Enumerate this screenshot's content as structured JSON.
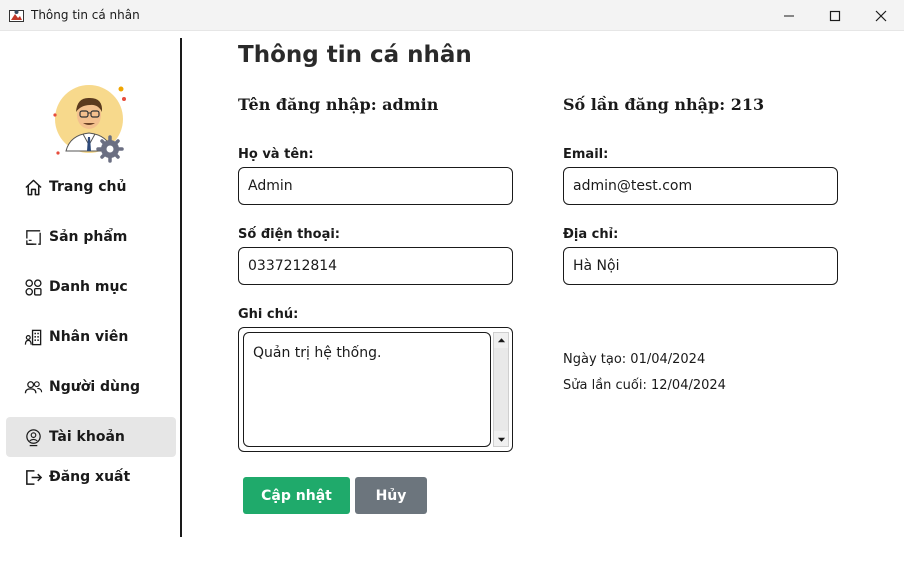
{
  "window": {
    "title": "Thông tin cá nhân",
    "icons": [
      "app-icon",
      "minimize-icon",
      "maximize-icon",
      "close-icon"
    ]
  },
  "sidebar": {
    "avatar_icon": "user-avatar-with-gear",
    "items": [
      {
        "label": "Trang chủ",
        "icon": "home-icon"
      },
      {
        "label": "Sản phẩm",
        "icon": "product-box-icon"
      },
      {
        "label": "Danh mục",
        "icon": "category-grid-icon"
      },
      {
        "label": "Nhân viên",
        "icon": "employee-building-icon"
      },
      {
        "label": "Người dùng",
        "icon": "users-icon"
      },
      {
        "label": "Tài khoản",
        "icon": "account-icon",
        "active": true
      },
      {
        "label": "Đăng xuất",
        "icon": "logout-icon"
      }
    ]
  },
  "main": {
    "title": "Thông tin cá nhân",
    "username_line": "Tên đăng nhập: admin",
    "login_count_line": "Số lần đăng nhập: 213",
    "fields": {
      "fullname": {
        "label": "Họ và tên:",
        "value": "Admin"
      },
      "email": {
        "label": "Email:",
        "value": "admin@test.com"
      },
      "phone": {
        "label": "Số điện thoại:",
        "value": "0337212814"
      },
      "address": {
        "label": "Địa chỉ:",
        "value": "Hà Nội"
      },
      "notes": {
        "label": "Ghi chú:",
        "value": "Quản trị hệ thống."
      }
    },
    "created": "Ngày tạo: 01/04/2024",
    "modified": "Sửa lần cuối: 12/04/2024",
    "buttons": {
      "update": "Cập nhật",
      "cancel": "Hủy"
    }
  },
  "colors": {
    "update_button": "#1faa6b",
    "cancel_button": "#6c757d",
    "active_nav": "#e6e6e6"
  }
}
